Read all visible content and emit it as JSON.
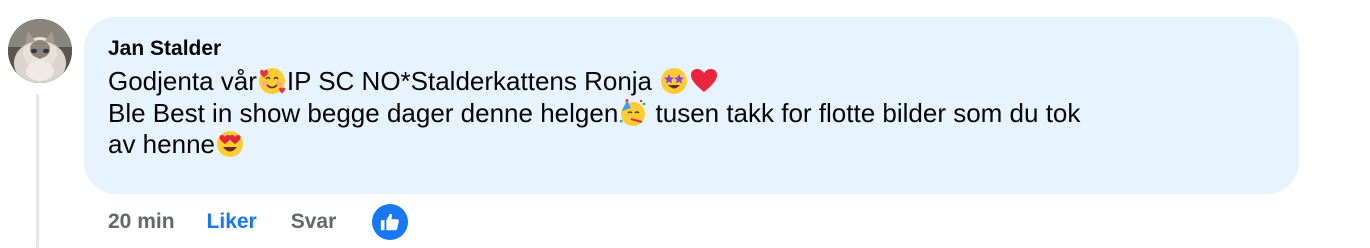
{
  "comment": {
    "author": "Jan Stalder",
    "line1_a": "Godjenta vår",
    "line1_b": "IP SC NO*Stalderkattens Ronja ",
    "line2_a": "Ble Best in show begge dager denne helgen",
    "line2_b": " tusen takk for flotte bilder som du tok",
    "line3_a": "av henne",
    "emojis": [
      "smiling-face-with-hearts",
      "star-struck",
      "red-heart",
      "partying-face",
      "heart-eyes"
    ]
  },
  "actions": {
    "time": "20 min",
    "like_label": "Liker",
    "reply_label": "Svar",
    "reaction_icon": "thumbs-up-icon"
  },
  "colors": {
    "bubble": "#e7f3ff",
    "like_blue": "#1877f2",
    "muted": "#65676b",
    "text": "#050505"
  }
}
